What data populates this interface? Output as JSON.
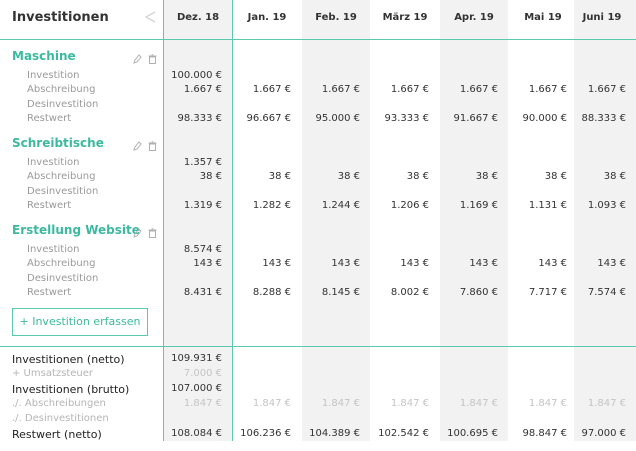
{
  "header": {
    "title": "Investitionen"
  },
  "months": [
    "Dez. 18",
    "Jan. 19",
    "Feb. 19",
    "März 19",
    "Apr. 19",
    "Mai 19",
    "Juni 19"
  ],
  "row_labels": {
    "investition": "Investition",
    "abschreibung": "Abschreibung",
    "desinvestition": "Desinvestition",
    "restwert": "Restwert"
  },
  "groups": [
    {
      "title": "Maschine",
      "investition": [
        "100.000 €",
        "",
        "",
        "",
        "",
        "",
        ""
      ],
      "abschreibung": [
        "1.667 €",
        "1.667 €",
        "1.667 €",
        "1.667 €",
        "1.667 €",
        "1.667 €",
        "1.667 €"
      ],
      "restwert": [
        "98.333 €",
        "96.667 €",
        "95.000 €",
        "93.333 €",
        "91.667 €",
        "90.000 €",
        "88.333 €"
      ]
    },
    {
      "title": "Schreibtische",
      "investition": [
        "1.357 €",
        "",
        "",
        "",
        "",
        "",
        ""
      ],
      "abschreibung": [
        "38 €",
        "38 €",
        "38 €",
        "38 €",
        "38 €",
        "38 €",
        "38 €"
      ],
      "restwert": [
        "1.319 €",
        "1.282 €",
        "1.244 €",
        "1.206 €",
        "1.169 €",
        "1.131 €",
        "1.093 €"
      ]
    },
    {
      "title": "Erstellung Website",
      "investition": [
        "8.574 €",
        "",
        "",
        "",
        "",
        "",
        ""
      ],
      "abschreibung": [
        "143 €",
        "143 €",
        "143 €",
        "143 €",
        "143 €",
        "143 €",
        "143 €"
      ],
      "restwert": [
        "8.431 €",
        "8.288 €",
        "8.145 €",
        "8.002 €",
        "7.860 €",
        "7.717 €",
        "7.574 €"
      ]
    }
  ],
  "add_button": "+ Investition erfassen",
  "summary": {
    "labels": {
      "netto": "Investitionen (netto)",
      "ust": "+ Umsatzsteuer",
      "brutto": "Investitionen (brutto)",
      "abschreibungen": "./. Abschreibungen",
      "desinvestitionen": "./. Desinvestitionen",
      "restwert": "Restwert (netto)"
    },
    "netto": [
      "109.931 €",
      "",
      "",
      "",
      "",
      "",
      ""
    ],
    "ust": [
      "7.000 €",
      "",
      "",
      "",
      "",
      "",
      ""
    ],
    "brutto": [
      "107.000 €",
      "",
      "",
      "",
      "",
      "",
      ""
    ],
    "abschreibungen": [
      "1.847 €",
      "1.847 €",
      "1.847 €",
      "1.847 €",
      "1.847 €",
      "1.847 €",
      "1.847 €"
    ],
    "restwert": [
      "108.084 €",
      "106.236 €",
      "104.389 €",
      "102.542 €",
      "100.695 €",
      "98.847 €",
      "97.000 €"
    ]
  },
  "colors": {
    "accent": "#3db9a0",
    "line": "#5cc8b0",
    "shade": "#f2f2f2"
  },
  "icons": {
    "share": "share-icon",
    "edit": "pencil-icon",
    "delete": "trash-icon"
  }
}
